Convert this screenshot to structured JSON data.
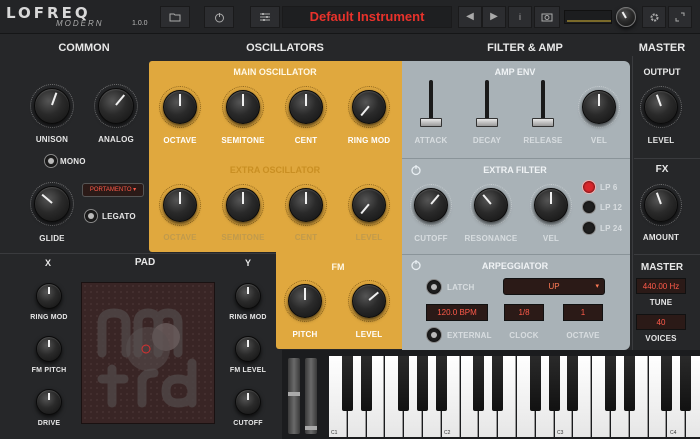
{
  "app": {
    "logo_main": "LOFREQ",
    "logo_sub": "MODERN",
    "version": "1.0.0",
    "preset_name": "Default Instrument"
  },
  "toolbar": {
    "folder_icon": "folder-icon",
    "power_icon": "power-icon",
    "sliders_icon": "sliders-icon",
    "prev": "◀",
    "next": "▶",
    "info": "i",
    "camera_icon": "camera-icon",
    "settings_icon": "gear-icon"
  },
  "sections": {
    "common": "COMMON",
    "oscillators": "OSCILLATORS",
    "filter_amp": "FILTER & AMP",
    "master": "MASTER"
  },
  "common": {
    "unison": "UNISON",
    "analog": "ANALOG",
    "mono": "MONO",
    "portamento": "PORTAMENTO ▾",
    "glide": "GLIDE",
    "legato": "LEGATO"
  },
  "main_osc": {
    "title": "MAIN OSCILLATOR",
    "octave": "OCTAVE",
    "semitone": "SEMITONE",
    "cent": "CENT",
    "ringmod": "RING MOD"
  },
  "extra_osc": {
    "title": "EXTRA OSCILLATOR",
    "octave": "OCTAVE",
    "semitone": "SEMITONE",
    "cent": "CENT",
    "level": "LEVEL"
  },
  "fm": {
    "title": "FM",
    "pitch": "PITCH",
    "level": "LEVEL"
  },
  "amp_env": {
    "title": "AMP ENV",
    "attack": "ATTACK",
    "decay": "DECAY",
    "release": "RELEASE",
    "vel": "VEL"
  },
  "extra_filter": {
    "title": "EXTRA FILTER",
    "cutoff": "CUTOFF",
    "resonance": "RESONANCE",
    "vel": "VEL",
    "lp6": "LP 6",
    "lp12": "LP 12",
    "lp24": "LP 24"
  },
  "arp": {
    "title": "ARPEGGIATOR",
    "latch": "LATCH",
    "mode": "UP",
    "bpm": "120.0 BPM",
    "external": "EXTERNAL",
    "clock_value": "1/8",
    "clock": "CLOCK",
    "octave_value": "1",
    "octave": "OCTAVE"
  },
  "pad": {
    "x": "X",
    "y": "Y",
    "title": "PAD",
    "ringmod": "RING MOD",
    "fmpitch": "FM PITCH",
    "drive": "DRIVE",
    "ringmod_r": "RING MOD",
    "fmlevel": "FM LEVEL",
    "cutoff": "CUTOFF"
  },
  "master": {
    "output": "OUTPUT",
    "level": "LEVEL",
    "fx": "FX",
    "amount": "AMOUNT",
    "master": "MASTER",
    "tune_value": "440.00 Hz",
    "tune": "TUNE",
    "voices_value": "40",
    "voices": "VOICES"
  },
  "keyboard": {
    "c1": "C1",
    "c2": "C2",
    "c3": "C3",
    "c4": "C4"
  }
}
